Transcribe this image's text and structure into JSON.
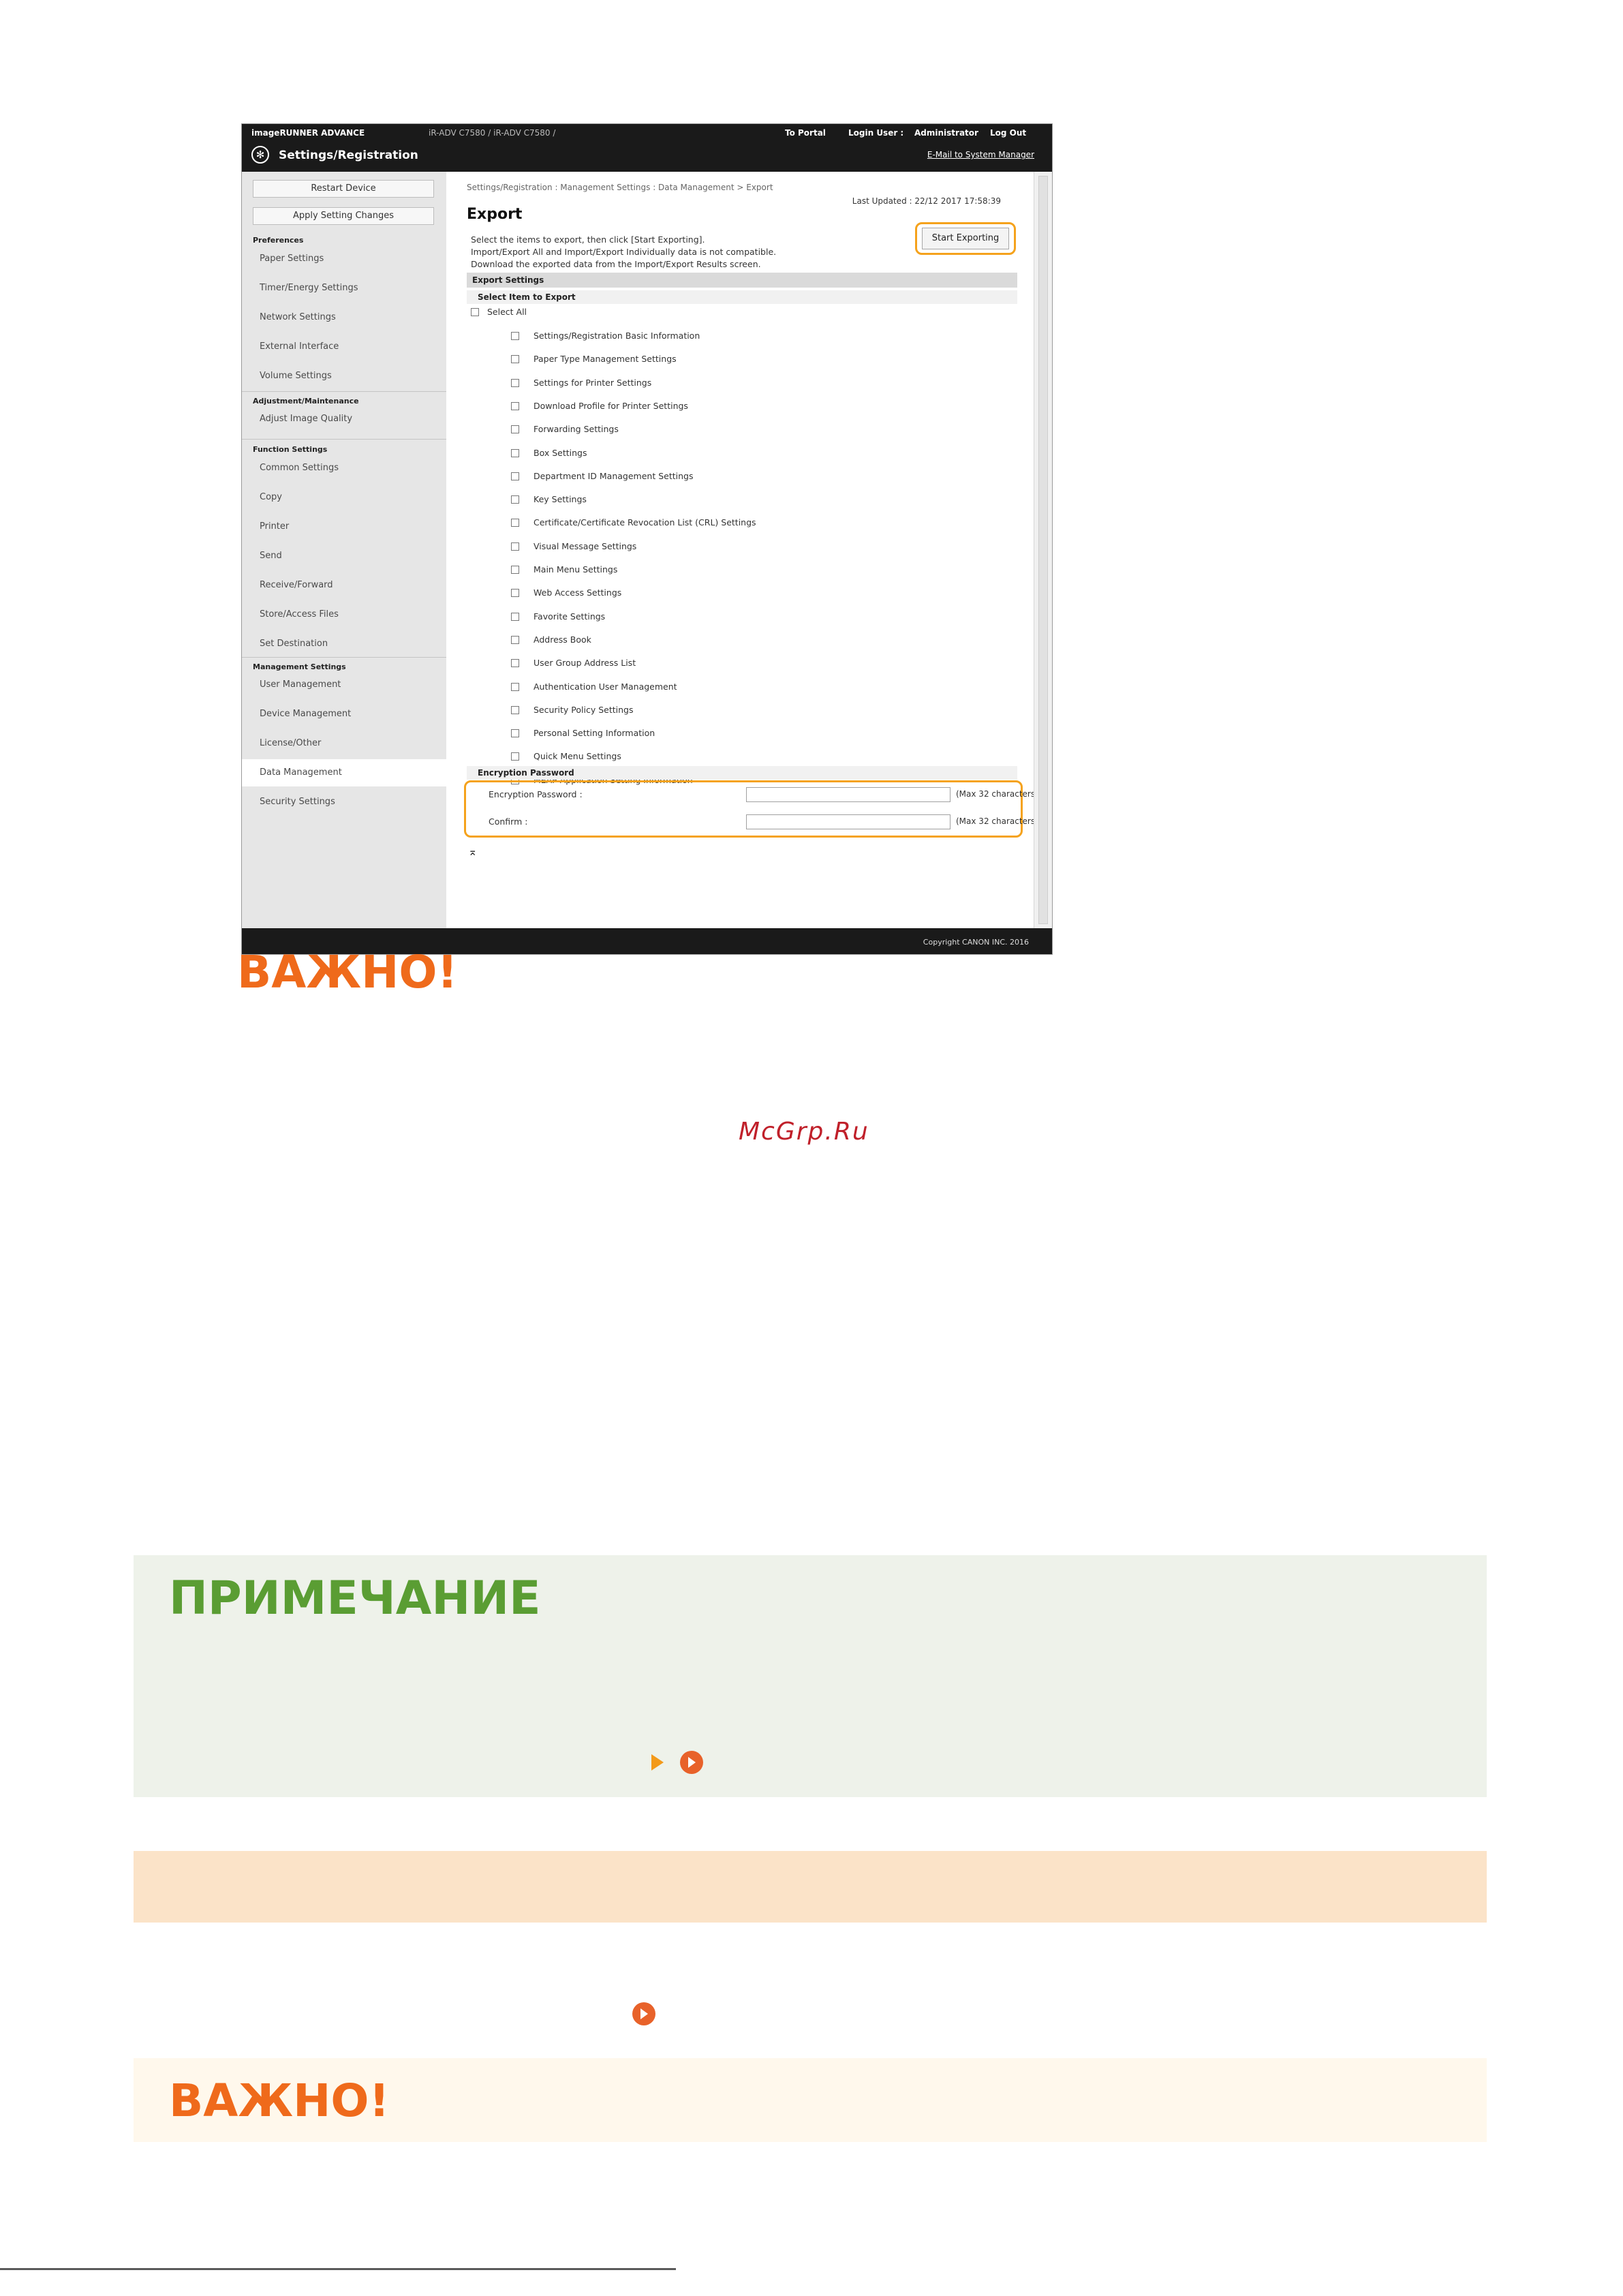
{
  "screenshot": {
    "header": {
      "product": "imageRUNNER ADVANCE",
      "device_names": "iR-ADV C7580 / iR-ADV C7580 /",
      "to_portal": "To Portal",
      "login_user_label": "Login User :",
      "login_user": "Administrator",
      "logout": "Log Out",
      "title": "Settings/Registration",
      "email_link": "E-Mail to System Manager"
    },
    "sidebar": {
      "restart_button": "Restart Device",
      "apply_button": "Apply Setting Changes",
      "groups": {
        "preferences": "Preferences",
        "adjustment": "Adjustment/Maintenance",
        "function": "Function Settings",
        "management": "Management Settings"
      },
      "items": {
        "paper": "Paper Settings",
        "timer": "Timer/Energy Settings",
        "network": "Network Settings",
        "external": "External Interface",
        "volume": "Volume Settings",
        "adjust_quality": "Adjust Image Quality",
        "common": "Common Settings",
        "copy": "Copy",
        "printer": "Printer",
        "send": "Send",
        "receive": "Receive/Forward",
        "store": "Store/Access Files",
        "set_destination": "Set Destination",
        "user_mgmt": "User Management",
        "device_mgmt": "Device Management",
        "license": "License/Other",
        "data_mgmt": "Data Management",
        "security": "Security Settings"
      }
    },
    "main": {
      "breadcrumb": "Settings/Registration : Management Settings : Data Management > Export",
      "last_updated": "Last Updated : 22/12 2017 17:58:39",
      "page_title": "Export",
      "desc1": "Select the items to export, then click [Start Exporting].",
      "desc2": "Import/Export All and Import/Export Individually data is not compatible.",
      "desc3": "Download the exported data from the Import/Export Results screen.",
      "start_button": "Start Exporting",
      "export_settings": "Export Settings",
      "select_items_heading": "Select Item to Export",
      "select_all": "Select All",
      "items": [
        "Settings/Registration Basic Information",
        "Paper Type Management Settings",
        "Settings for Printer Settings",
        "Download Profile for Printer Settings",
        "Forwarding Settings",
        "Box Settings",
        "Department ID Management Settings",
        "Key Settings",
        "Certificate/Certificate Revocation List (CRL) Settings",
        "Visual Message Settings",
        "Main Menu Settings",
        "Web Access Settings",
        "Favorite Settings",
        "Address Book",
        "User Group Address List",
        "Authentication User Management",
        "Security Policy Settings",
        "Personal Setting Information",
        "Quick Menu Settings",
        "MEAP Application Setting Information"
      ],
      "encryption_heading": "Encryption Password",
      "enc_label": "Encryption Password :",
      "confirm_label": "Confirm :",
      "max_note": "(Max 32 characters)",
      "to_top": "⌅"
    },
    "footer": "Copyright CANON INC. 2016"
  },
  "doc": {
    "important_title": "ВАЖНО!",
    "watermark": "McGrp.Ru",
    "note_title": "ПРИМЕЧАНИЕ",
    "important_title_2": "ВАЖНО!"
  },
  "colors": {
    "orange": "#ef6a1b",
    "green": "#5a9d33",
    "highlight_ring": "#f5a21c",
    "watermark_red": "#c0202a"
  },
  "icons": {
    "gear": "gear-icon",
    "arrow": "right-triangle-icon",
    "circle_play": "circle-play-icon"
  }
}
